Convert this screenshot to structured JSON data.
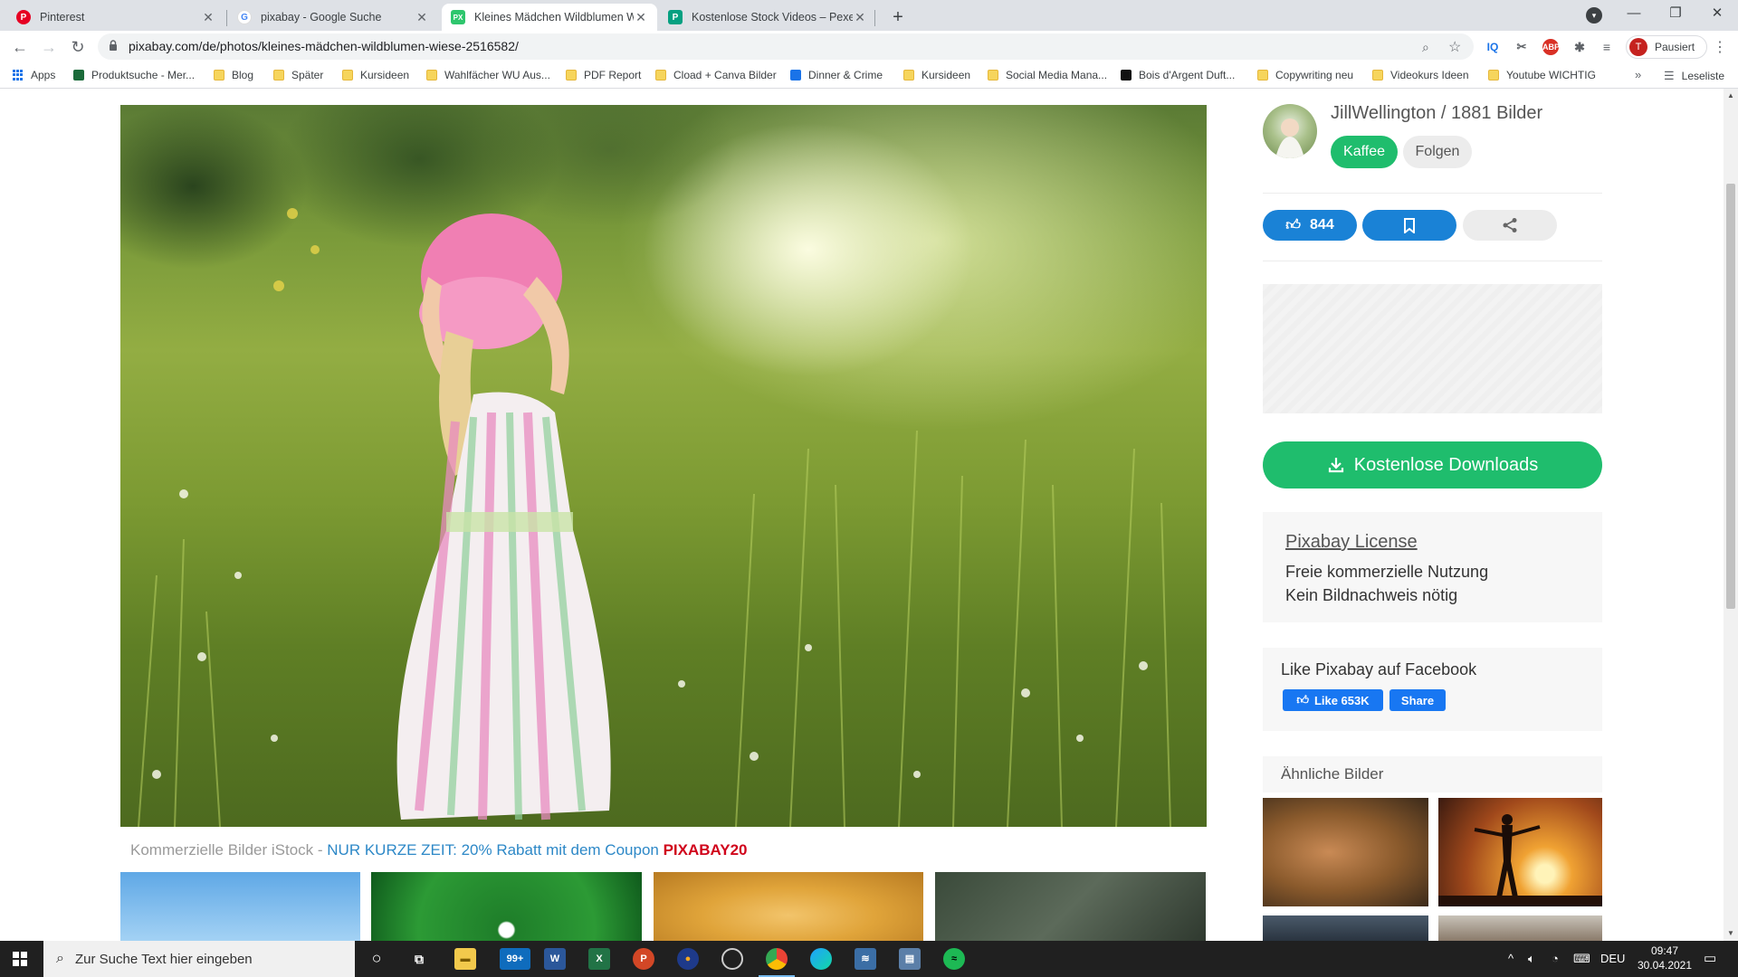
{
  "browser": {
    "tabs": [
      {
        "title": "Pinterest",
        "favicon_text": "P",
        "favicon_color": "#e60023",
        "active": false
      },
      {
        "title": "pixabay - Google Suche",
        "favicon_text": "G",
        "favicon_color": "#4285f4",
        "active": false
      },
      {
        "title": "Kleines Mädchen Wildblumen W",
        "favicon_text": "PX",
        "favicon_color": "#2ec66d",
        "active": true
      },
      {
        "title": "Kostenlose Stock Videos – Pexels",
        "favicon_text": "P",
        "favicon_color": "#05a081",
        "active": false
      }
    ],
    "url": "pixabay.com/de/photos/kleines-mädchen-wildblumen-wiese-2516582/",
    "profile_initial": "T",
    "profile_label": "Pausiert",
    "bookmarks": [
      {
        "label": "Apps",
        "type": "apps"
      },
      {
        "label": "Produktsuche - Mer...",
        "type": "site",
        "color": "#1b6b3a"
      },
      {
        "label": "Blog",
        "type": "folder"
      },
      {
        "label": "Später",
        "type": "folder"
      },
      {
        "label": "Kursideen",
        "type": "folder"
      },
      {
        "label": "Wahlfächer WU Aus...",
        "type": "folder"
      },
      {
        "label": "PDF Report",
        "type": "folder"
      },
      {
        "label": "Cload + Canva Bilder",
        "type": "folder"
      },
      {
        "label": "Dinner & Crime",
        "type": "site",
        "color": "#1a73e8"
      },
      {
        "label": "Kursideen",
        "type": "folder"
      },
      {
        "label": "Social Media Mana...",
        "type": "folder"
      },
      {
        "label": "Bois d'Argent Duft...",
        "type": "site",
        "color": "#111111"
      },
      {
        "label": "Copywriting neu",
        "type": "folder"
      },
      {
        "label": "Videokurs Ideen",
        "type": "folder"
      },
      {
        "label": "Youtube WICHTIG",
        "type": "folder"
      }
    ],
    "reading_list": "Leseliste"
  },
  "page": {
    "ad_line": {
      "prefix": "Kommerzielle Bilder iStock - ",
      "promo": "NUR KURZE ZEIT: 20% Rabatt mit dem Coupon ",
      "coupon": "PIXABAY20"
    },
    "author": {
      "name": "JillWellington / 1881 Bilder",
      "coffee_label": "Kaffee",
      "follow_label": "Folgen"
    },
    "actions": {
      "likes": "844"
    },
    "download_label": "Kostenlose Downloads",
    "license": {
      "title": "Pixabay License",
      "line1": "Freie kommerzielle Nutzung",
      "line2": "Kein Bildnachweis nötig"
    },
    "facebook": {
      "title": "Like Pixabay auf Facebook",
      "like_label": "Like 653K",
      "share_label": "Share"
    },
    "similar_title": "Ähnliche Bilder"
  },
  "taskbar": {
    "search_placeholder": "Zur Suche Text hier eingeben",
    "mail_badge": "99+",
    "language": "DEU",
    "time": "09:47",
    "date": "30.04.2021"
  },
  "colors": {
    "accent_green": "#1fbd6d",
    "accent_blue": "#1a82d6",
    "facebook_blue": "#1877f2",
    "coupon_red": "#d0021b"
  }
}
